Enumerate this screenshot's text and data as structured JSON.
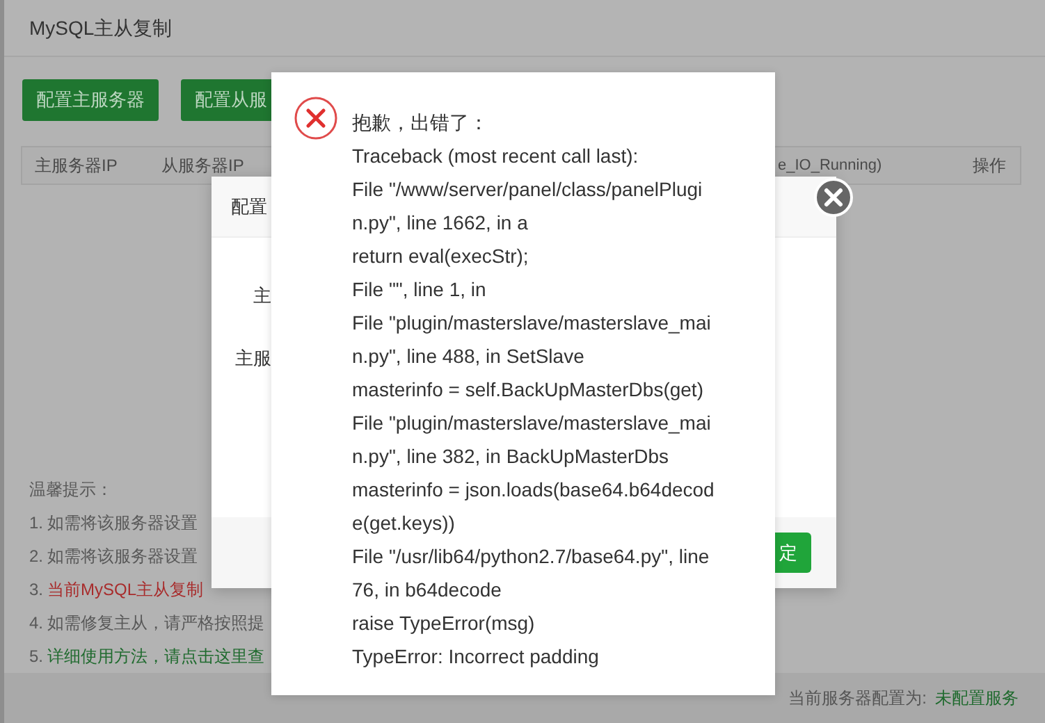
{
  "window": {
    "title": "MySQL主从复制"
  },
  "toolbar": {
    "buttons": [
      "配置主服务器",
      "配置从服"
    ]
  },
  "table": {
    "columns": [
      "主服务器IP",
      "从服务器IP",
      "e_IO_Running)",
      "操作"
    ]
  },
  "tips": {
    "title": "温馨提示：",
    "items": [
      {
        "number": "1.",
        "text": "如需将该服务器设置",
        "kind": "plain"
      },
      {
        "number": "2.",
        "text": "如需将该服务器设置",
        "kind": "plain"
      },
      {
        "number": "3.",
        "text": "当前MySQL主从复制",
        "kind": "warning"
      },
      {
        "number": "4.",
        "text": "如需修复主从，请严格按照提",
        "kind": "plain"
      },
      {
        "number": "5.",
        "text": "详细使用方法，请点击这里查",
        "kind": "link"
      }
    ]
  },
  "status_bar": {
    "label": "当前服务器配置为:",
    "value": "未配置服务"
  },
  "config_dialog": {
    "title": "配置",
    "labels": [
      "主",
      "主服"
    ],
    "confirm_button": "定"
  },
  "error_dialog": {
    "heading": "抱歉，出错了：",
    "lines": [
      "Traceback (most recent call last):",
      "File \"/www/server/panel/class/panelPlugi",
      "n.py\", line 1662, in a",
      "return eval(execStr);",
      "File \"\", line 1, in",
      "File \"plugin/masterslave/masterslave_mai",
      "n.py\", line 488, in SetSlave",
      "masterinfo = self.BackUpMasterDbs(get)",
      "File \"plugin/masterslave/masterslave_mai",
      "n.py\", line 382, in BackUpMasterDbs",
      "masterinfo = json.loads(base64.b64decod",
      "e(get.keys))",
      "File \"/usr/lib64/python2.7/base64.py\", line",
      "76, in b64decode",
      "raise TypeError(msg)",
      "TypeError: Incorrect padding"
    ]
  }
}
